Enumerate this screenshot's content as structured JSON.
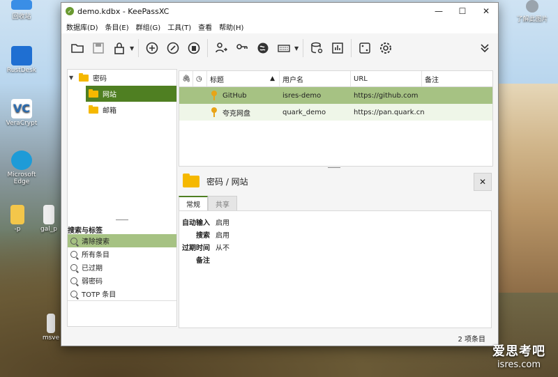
{
  "desktop": {
    "icons": [
      {
        "label": "回收站",
        "color": "#3a8ee6"
      },
      {
        "label": "RustDesk",
        "color": "#1f6fd2"
      },
      {
        "label": "VeraCrypt",
        "color": "#2b6cb0"
      },
      {
        "label": "Microsoft Edge",
        "color": "#1e9bd7"
      },
      {
        "label": "-p",
        "color": "#f3c64a"
      },
      {
        "label": "gal_p",
        "color": "#eeeeee"
      },
      {
        "label": "msve",
        "color": "#dddddd"
      },
      {
        "label": "了解此图片",
        "color": "#9aa4ad"
      }
    ]
  },
  "window": {
    "title": "demo.kdbx - KeePassXC",
    "controls": {
      "minimize": "—",
      "maximize": "☐",
      "close": "✕"
    }
  },
  "menu": [
    "数据库(D)",
    "条目(E)",
    "群组(G)",
    "工具(T)",
    "查看",
    "帮助(H)"
  ],
  "toolbar": {
    "buttons": [
      "open-database-icon",
      "save-database-icon",
      "lock-database-icon",
      "add-entry-icon",
      "edit-entry-icon",
      "delete-entry-icon",
      "copy-username-icon",
      "copy-password-icon",
      "open-url-icon",
      "autotype-icon",
      "database-settings-icon",
      "database-reports-icon",
      "password-generator-icon",
      "settings-icon",
      "overflow-icon"
    ]
  },
  "groups": {
    "root": "密码",
    "children": [
      "网站",
      "邮箱"
    ]
  },
  "tags": {
    "title": "搜索与标签",
    "items": [
      "清除搜索",
      "所有条目",
      "已过期",
      "弱密码",
      "TOTP 条目"
    ]
  },
  "table": {
    "headers": [
      "",
      "",
      "标题",
      "用户名",
      "URL",
      "备注"
    ],
    "rows": [
      {
        "title": "GitHub",
        "username": "isres-demo",
        "url": "https://github.com",
        "notes": ""
      },
      {
        "title": "夸克网盘",
        "username": "quark_demo",
        "url": "https://pan.quark.cn",
        "notes": ""
      }
    ]
  },
  "detail": {
    "path": "密码 / 网站",
    "close": "✕",
    "tabs": [
      "常规",
      "共享"
    ],
    "props": [
      {
        "key": "自动输入",
        "value": "启用"
      },
      {
        "key": "搜索",
        "value": "启用"
      },
      {
        "key": "过期时间",
        "value": "从不"
      },
      {
        "key": "备注",
        "value": ""
      }
    ]
  },
  "status": "2 项条目",
  "watermark": {
    "line1": "爱思考吧",
    "line2": "isres.com"
  }
}
